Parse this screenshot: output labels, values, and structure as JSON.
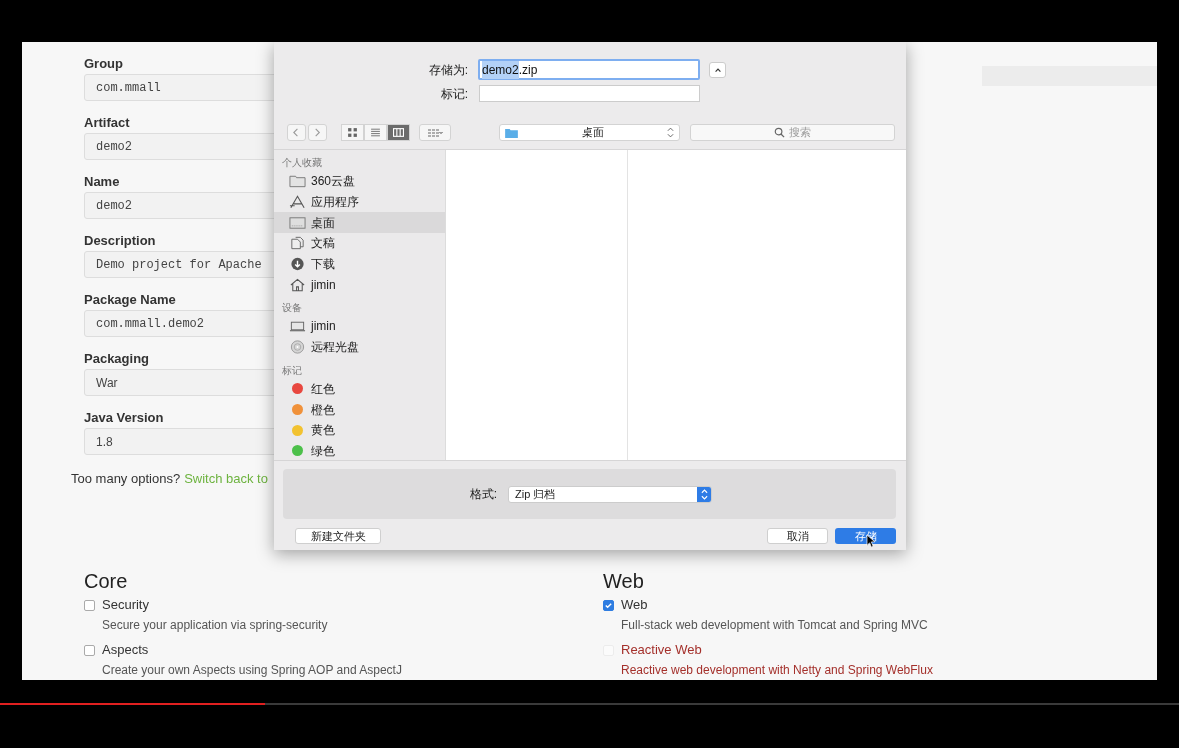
{
  "form": {
    "fields": [
      {
        "label": "Group",
        "value": "com.mmall",
        "kind": "text"
      },
      {
        "label": "Artifact",
        "value": "demo2",
        "kind": "text"
      },
      {
        "label": "Name",
        "value": "demo2",
        "kind": "text"
      },
      {
        "label": "Description",
        "value": "Demo project for Apache",
        "kind": "text"
      },
      {
        "label": "Package Name",
        "value": "com.mmall.demo2",
        "kind": "text"
      },
      {
        "label": "Packaging",
        "value": "War",
        "kind": "select"
      },
      {
        "label": "Java Version",
        "value": "1.8",
        "kind": "select"
      }
    ],
    "hint": "Too many options?",
    "link": "Switch back to"
  },
  "dependencies": [
    {
      "title": "Core",
      "items": [
        {
          "name": "Security",
          "description": "Secure your application via spring-security",
          "checked": false,
          "disabled": false
        },
        {
          "name": "Aspects",
          "description": "Create your own Aspects using Spring AOP and AspectJ",
          "checked": false,
          "disabled": false
        }
      ]
    },
    {
      "title": "Web",
      "items": [
        {
          "name": "Web",
          "description": "Full-stack web development with Tomcat and Spring MVC",
          "checked": true,
          "disabled": false
        },
        {
          "name": "Reactive Web",
          "description": "Reactive web development with Netty and Spring WebFlux",
          "checked": false,
          "disabled": true
        }
      ]
    }
  ],
  "save_dialog": {
    "save_as": {
      "label": "存储为:",
      "selected_text": "demo2",
      "rest_text": ".zip"
    },
    "tags": {
      "label": "标记:"
    },
    "toolbar": {
      "views": [
        {
          "kind": "icons",
          "selected": false
        },
        {
          "kind": "list",
          "selected": false
        },
        {
          "kind": "columns",
          "selected": true
        }
      ],
      "location": "桌面",
      "search_placeholder": "搜索"
    },
    "sidebar": [
      {
        "heading": "个人收藏",
        "items": [
          {
            "label": "360云盘",
            "kind": "folder",
            "selected": false
          },
          {
            "label": "应用程序",
            "kind": "apps",
            "selected": false
          },
          {
            "label": "桌面",
            "kind": "desktop",
            "selected": true
          },
          {
            "label": "文稿",
            "kind": "docs",
            "selected": false
          },
          {
            "label": "下载",
            "kind": "download",
            "selected": false
          },
          {
            "label": "jimin",
            "kind": "home",
            "selected": false
          }
        ]
      },
      {
        "heading": "设备",
        "items": [
          {
            "label": "jimin",
            "kind": "laptop",
            "selected": false
          },
          {
            "label": "远程光盘",
            "kind": "disc",
            "selected": false
          }
        ]
      },
      {
        "heading": "标记",
        "items": [
          {
            "label": "红色",
            "kind": "tag",
            "color": "#e8473f",
            "selected": false
          },
          {
            "label": "橙色",
            "kind": "tag",
            "color": "#f0913a",
            "selected": false
          },
          {
            "label": "黄色",
            "kind": "tag",
            "color": "#f2c230",
            "selected": false
          },
          {
            "label": "绿色",
            "kind": "tag",
            "color": "#4cc04a",
            "selected": false
          }
        ]
      }
    ],
    "format": {
      "label": "格式:",
      "value": "Zip 归档"
    },
    "buttons": {
      "new_folder": "新建文件夹",
      "cancel": "取消",
      "save": "存储"
    }
  },
  "video": {
    "progress": {
      "level": 0.225
    }
  }
}
